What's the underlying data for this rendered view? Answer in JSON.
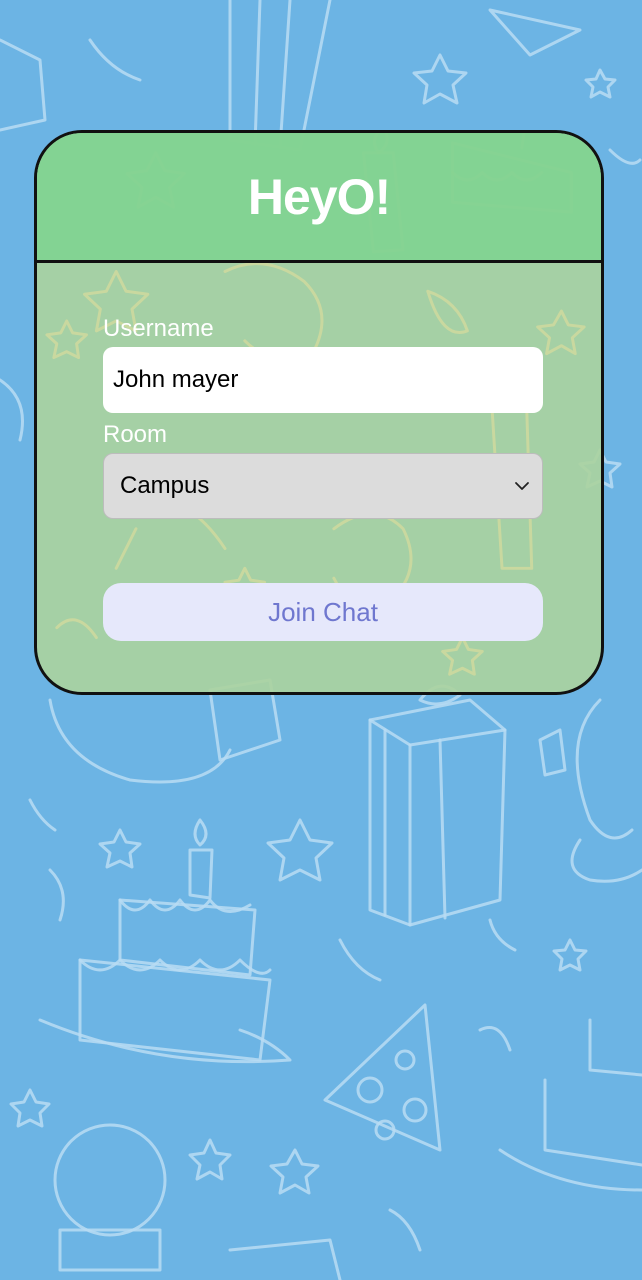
{
  "app": {
    "title": "HeyO!"
  },
  "form": {
    "username": {
      "label": "Username",
      "value": "John mayer"
    },
    "room": {
      "label": "Room",
      "selected": "Campus"
    },
    "join_button_label": "Join Chat"
  },
  "icons": {
    "select_arrow": "chevron-down-icon"
  },
  "colors": {
    "background": "#6cb4e4",
    "header": "#80d291",
    "card_body": "#aad2a0",
    "button_bg": "#e6e8fb",
    "button_text": "#6f77cf"
  }
}
